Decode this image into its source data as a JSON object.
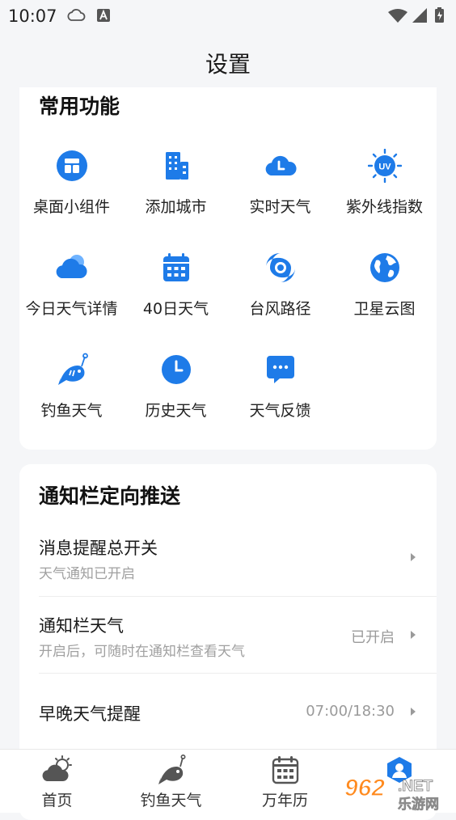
{
  "status": {
    "time": "10:07"
  },
  "header": {
    "title": "设置"
  },
  "common": {
    "title": "常用功能",
    "items": [
      {
        "label": "桌面小组件",
        "icon": "widget-icon"
      },
      {
        "label": "添加城市",
        "icon": "city-building-icon"
      },
      {
        "label": "实时天气",
        "icon": "cloud-clock-icon"
      },
      {
        "label": "紫外线指数",
        "icon": "uv-sun-icon"
      },
      {
        "label": "今日天气详情",
        "icon": "cloud-icon"
      },
      {
        "label": "40日天气",
        "icon": "calendar-icon"
      },
      {
        "label": "台风路径",
        "icon": "typhoon-icon"
      },
      {
        "label": "卫星云图",
        "icon": "globe-icon"
      },
      {
        "label": "钓鱼天气",
        "icon": "fish-icon"
      },
      {
        "label": "历史天气",
        "icon": "clock-icon"
      },
      {
        "label": "天气反馈",
        "icon": "feedback-chat-icon"
      }
    ]
  },
  "notify": {
    "title": "通知栏定向推送",
    "rows": [
      {
        "title": "消息提醒总开关",
        "subtitle": "天气通知已开启",
        "value": ""
      },
      {
        "title": "通知栏天气",
        "subtitle": "开启后，可随时在通知栏查看天气",
        "value": "已开启"
      },
      {
        "title": "早晚天气提醒",
        "subtitle": "",
        "value": "07:00/18:30"
      }
    ]
  },
  "nav": {
    "items": [
      {
        "label": "首页",
        "icon": "weather-home-icon"
      },
      {
        "label": "钓鱼天气",
        "icon": "fish-icon"
      },
      {
        "label": "万年历",
        "icon": "calendar-icon"
      },
      {
        "label": "",
        "icon": "profile-icon"
      }
    ]
  },
  "watermark": {
    "text_main": "962",
    "text_net": ".NET",
    "text_sub": "乐游网"
  },
  "colors": {
    "accent": "#1e7be8",
    "text": "#1a1a1a",
    "subtext": "#a0a0a0"
  }
}
